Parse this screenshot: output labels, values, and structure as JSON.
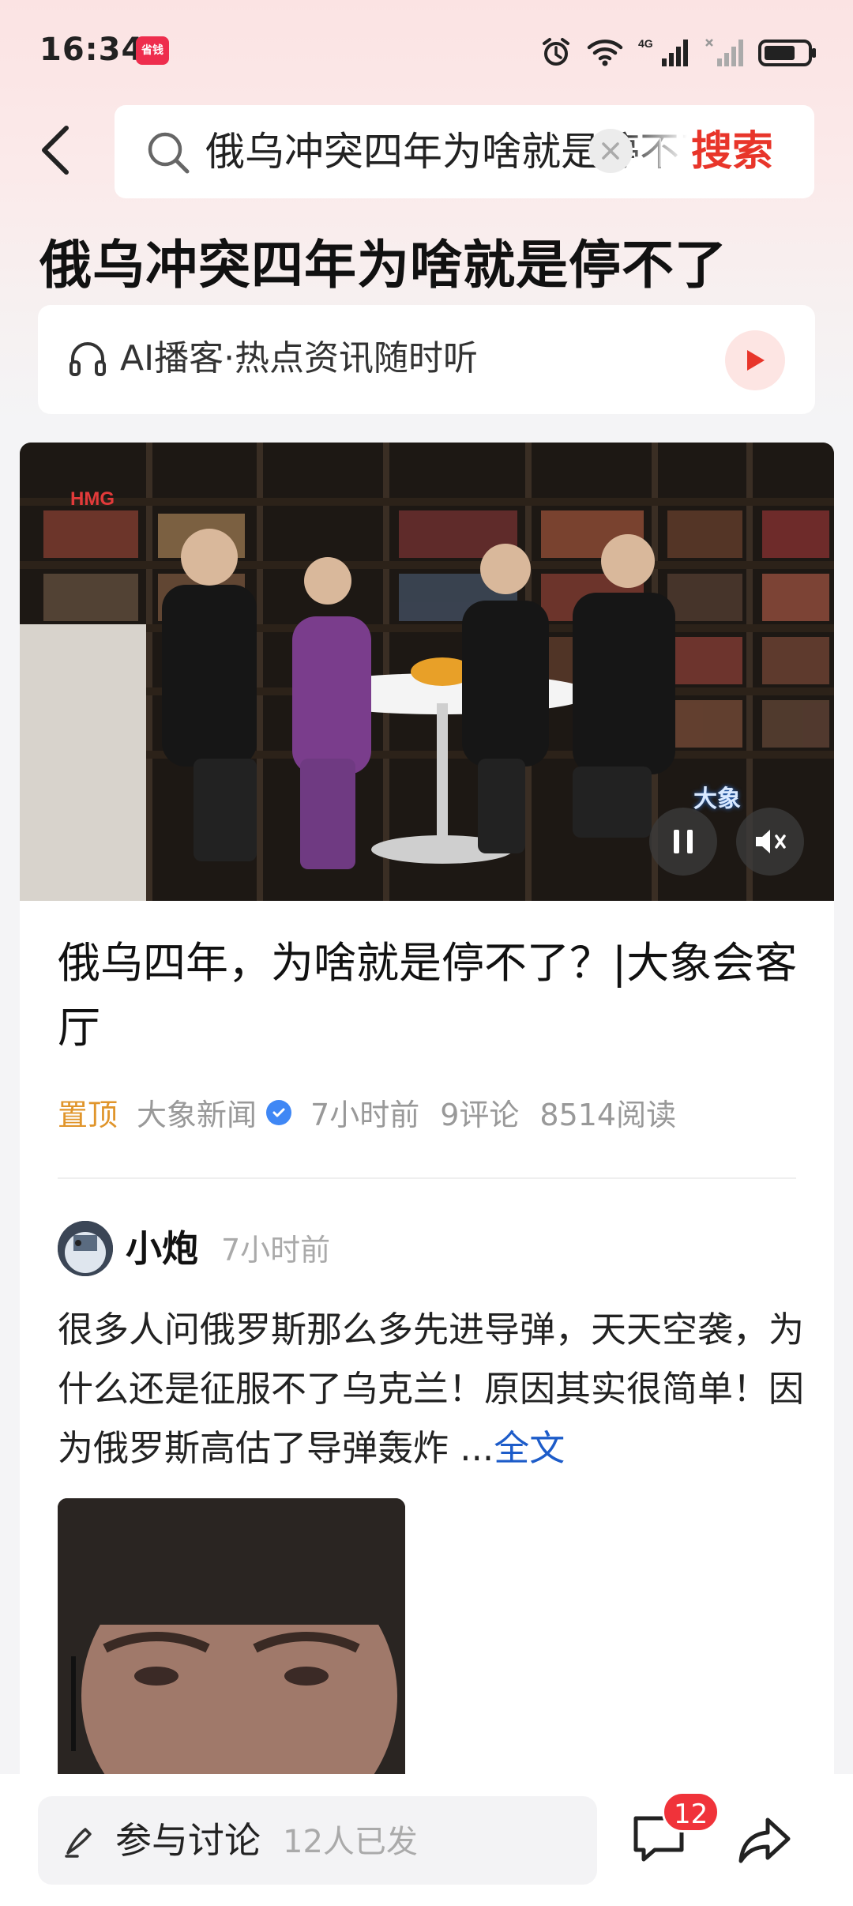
{
  "status_bar": {
    "time": "16:34",
    "app_badge": "省钱"
  },
  "search": {
    "query": "俄乌冲突四年为啥就是停不了",
    "submit_label": "搜索"
  },
  "topic": {
    "title": "俄乌冲突四年为啥就是停不了"
  },
  "podcast": {
    "label": "AI播客·热点资讯随时听"
  },
  "video": {
    "logo_text": "HMG",
    "badge": "大象"
  },
  "article": {
    "title": "俄乌四年，为啥就是停不了？|大象会客厅",
    "pin_label": "置顶",
    "source": "大象新闻",
    "time": "7小时前",
    "comments": "9评论",
    "reads": "8514阅读"
  },
  "post": {
    "author": "小炮",
    "time": "7小时前",
    "body": "很多人问俄罗斯那么多先进导弹，天天空袭，为什么还是征服不了乌克兰！原因其实很简单！因为俄罗斯高估了导弹轰炸 ...",
    "more_label": "全文"
  },
  "bottom_bar": {
    "discuss_label": "参与讨论",
    "discuss_count": "12人已发",
    "comment_badge": "12"
  },
  "colors": {
    "accent_red": "#e8352a",
    "pin_orange": "#e0952b",
    "link_blue": "#1d5cc9",
    "verified_blue": "#3f87f5"
  }
}
